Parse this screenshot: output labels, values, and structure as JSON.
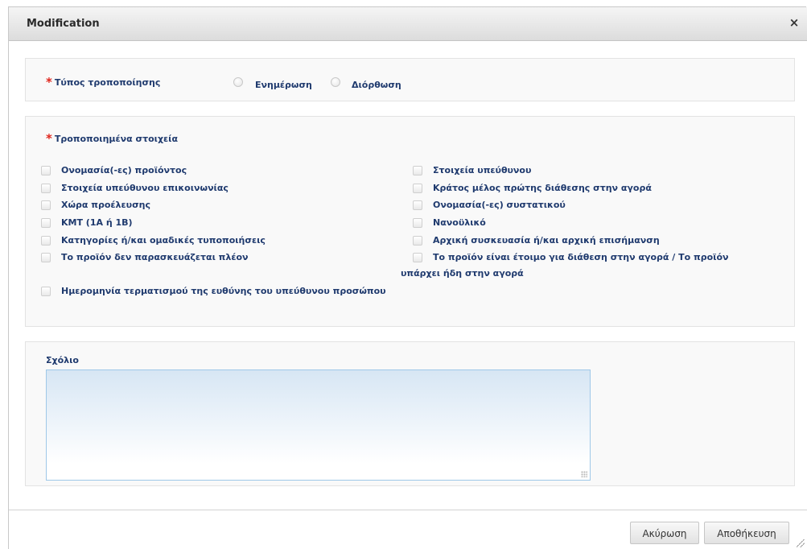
{
  "dialog": {
    "title": "Modification",
    "close_symbol": "×"
  },
  "modification_type": {
    "required_mark": "*",
    "label": "Τύπος τροποποίησης",
    "options": [
      {
        "label": "Ενημέρωση",
        "selected": false
      },
      {
        "label": "Διόρθωση",
        "selected": false
      }
    ]
  },
  "modified_items": {
    "required_mark": "*",
    "label": "Τροποποιημένα στοιχεία",
    "left_column": [
      "Ονομασία(-ες) προϊόντος",
      "Στοιχεία υπεύθυνου επικοινωνίας",
      "Χώρα προέλευσης",
      "ΚΜΤ (1Α ή 1Β)",
      "Κατηγορίες ή/και ομαδικές τυποποιήσεις",
      "Το προϊόν δεν παρασκευάζεται πλέον",
      "Ημερομηνία τερματισμού της ευθύνης του υπεύθυνου προσώπου"
    ],
    "right_column": [
      "Στοιχεία υπεύθυνου",
      "Κράτος μέλος πρώτης διάθεσης στην αγορά",
      "Ονομασία(-ες) συστατικού",
      "Νανοϋλικό",
      "Αρχική συσκευασία ή/και αρχική επισήμανση",
      "Το προϊόν είναι έτοιμο για διάθεση στην αγορά / Το προϊόν υπάρχει ήδη στην αγορά"
    ]
  },
  "comment": {
    "label": "Σχόλιο",
    "value": ""
  },
  "buttons": {
    "cancel": "Ακύρωση",
    "save": "Αποθήκευση"
  },
  "colors": {
    "label_blue": "#1f3a6e",
    "required_red": "#e0261c",
    "title_bar": "#dcdcdc"
  }
}
